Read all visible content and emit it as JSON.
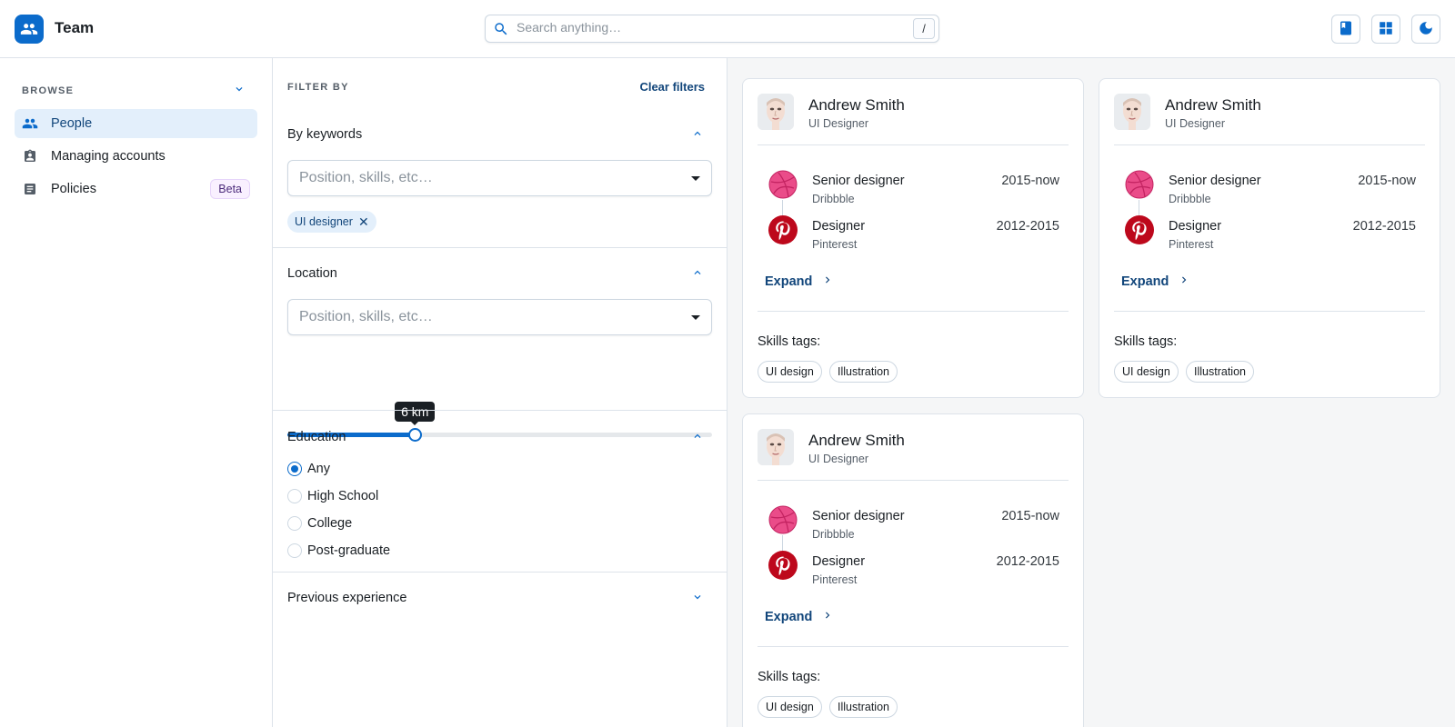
{
  "app": {
    "title": "Team"
  },
  "search": {
    "placeholder": "Search anything…",
    "shortcut": "/"
  },
  "header_buttons": [
    {
      "icon": "book-icon"
    },
    {
      "icon": "grid-icon"
    },
    {
      "icon": "moon-icon"
    }
  ],
  "sidebar": {
    "section_label": "BROWSE",
    "items": [
      {
        "label": "People",
        "icon": "people-icon",
        "active": true
      },
      {
        "label": "Managing accounts",
        "icon": "badge-icon",
        "active": false
      },
      {
        "label": "Policies",
        "icon": "document-icon",
        "active": false,
        "badge": "Beta"
      }
    ]
  },
  "filters": {
    "heading": "FILTER BY",
    "clear_label": "Clear filters",
    "keywords": {
      "title": "By keywords",
      "placeholder": "Position, skills, etc…",
      "chips": [
        "UI designer"
      ]
    },
    "location": {
      "title": "Location",
      "placeholder": "Position, skills, etc…",
      "distance_label": "6 km",
      "slider_fraction": 0.3
    },
    "education": {
      "title": "Education",
      "options": [
        "Any",
        "High School",
        "College",
        "Post-graduate"
      ],
      "selected": "Any"
    },
    "previous_experience": {
      "title": "Previous experience"
    }
  },
  "cards": [
    {
      "name": "Andrew Smith",
      "role": "UI Designer",
      "experience": [
        {
          "title": "Senior designer",
          "company": "Dribbble",
          "years": "2015-now",
          "logo": "dribbble-icon"
        },
        {
          "title": "Designer",
          "company": "Pinterest",
          "years": "2012-2015",
          "logo": "pinterest-icon"
        }
      ],
      "expand_label": "Expand",
      "skills_label": "Skills tags:",
      "skills": [
        "UI design",
        "Illustration"
      ]
    },
    {
      "name": "Andrew Smith",
      "role": "UI Designer",
      "experience": [
        {
          "title": "Senior designer",
          "company": "Dribbble",
          "years": "2015-now",
          "logo": "dribbble-icon"
        },
        {
          "title": "Designer",
          "company": "Pinterest",
          "years": "2012-2015",
          "logo": "pinterest-icon"
        }
      ],
      "expand_label": "Expand",
      "skills_label": "Skills tags:",
      "skills": [
        "UI design",
        "Illustration"
      ]
    },
    {
      "name": "Andrew Smith",
      "role": "UI Designer",
      "experience": [
        {
          "title": "Senior designer",
          "company": "Dribbble",
          "years": "2015-now",
          "logo": "dribbble-icon"
        },
        {
          "title": "Designer",
          "company": "Pinterest",
          "years": "2012-2015",
          "logo": "pinterest-icon"
        }
      ],
      "expand_label": "Expand",
      "skills_label": "Skills tags:",
      "skills": [
        "UI design",
        "Illustration"
      ]
    }
  ],
  "colors": {
    "primary": "#0b6bcb",
    "primary_dark": "#12467b",
    "dribbble": "#ea4c89",
    "pinterest": "#bd081c",
    "beta_bg": "#f9f0ff"
  }
}
